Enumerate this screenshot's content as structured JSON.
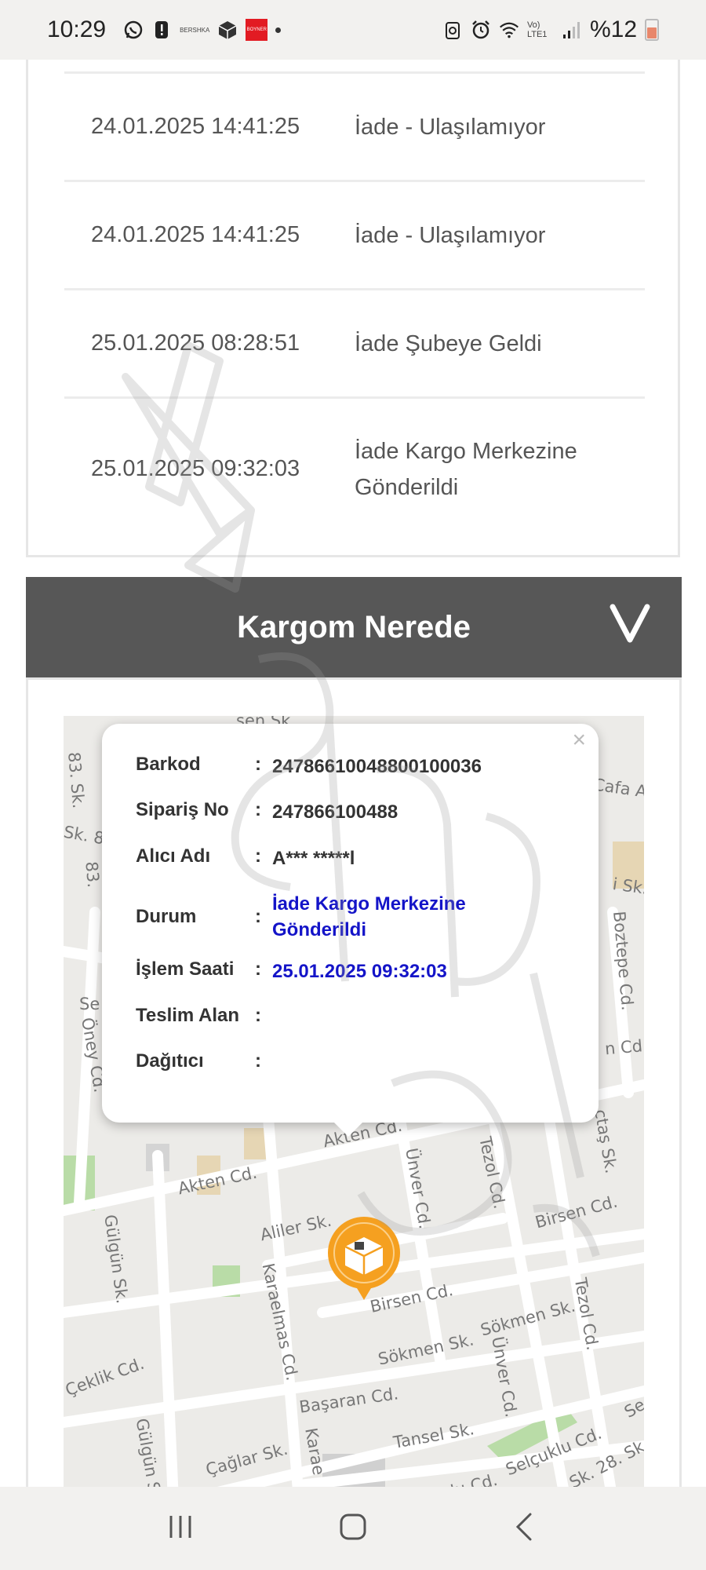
{
  "status_bar": {
    "time": "10:29",
    "notif_small_text": "BERSHKA",
    "notif_brand_text": "BOYNER",
    "network_label": "Vo) LTE1",
    "battery": "%12"
  },
  "tracking": {
    "rows": [
      {
        "date": "24.01.2025 14:41:25",
        "status": "İade - Ulaşılamıyor"
      },
      {
        "date": "24.01.2025 14:41:25",
        "status": "İade - Ulaşılamıyor"
      },
      {
        "date": "25.01.2025 08:28:51",
        "status": "İade Şubeye Geldi"
      },
      {
        "date": "25.01.2025 09:32:03",
        "status": "İade Kargo Merkezine Gönderildi"
      }
    ]
  },
  "section": {
    "title": "Kargom Nerede",
    "toggle_glyph": "V"
  },
  "popup": {
    "close": "×",
    "separator": ":",
    "rows": [
      {
        "label": "Barkod",
        "value": "24786610048800100036"
      },
      {
        "label": "Sipariş No",
        "value": "247866100488"
      },
      {
        "label": "Alıcı Adı",
        "value": "A*** *****l"
      },
      {
        "label": "Durum",
        "value": "İade Kargo Merkezine Gönderildi"
      },
      {
        "label": "İşlem Saati",
        "value": "25.01.2025 09:32:03"
      },
      {
        "label": "Teslim Alan",
        "value": ""
      },
      {
        "label": "Dağıtıcı",
        "value": ""
      }
    ]
  },
  "map": {
    "streets": [
      "Akten Cd.",
      "Akten Cd.",
      "Aliler Sk.",
      "Karaelmas Cd.",
      "Gülgün Sk.",
      "Ünver Cd.",
      "Tezol Cd.",
      "Birsen Cd.",
      "Birsen Cd.",
      "Sökmen Sk.",
      "Sökmen Sk.",
      "Başaran Cd.",
      "Tansel Sk.",
      "Selçuklu Cd.",
      "Çağlar Sk.",
      "Öney Cd.",
      "Boztepe Cd.",
      "Tezol Cd.",
      "Ünver Cd.",
      "Gülgün S",
      "Çeklik Cd.",
      "83. Sk.",
      "Sk. 8",
      "83.",
      "Cafa A",
      "i Sk.",
      "n Cd.",
      "ctaş Sk.",
      "Se",
      "Karae",
      "Sk. 28. Sk.",
      "Se",
      "ulu Cd.",
      "sen Sk"
    ]
  },
  "colors": {
    "accent_blue": "#1414c8",
    "header_gray": "#575757",
    "pin_orange": "#f5a020"
  }
}
